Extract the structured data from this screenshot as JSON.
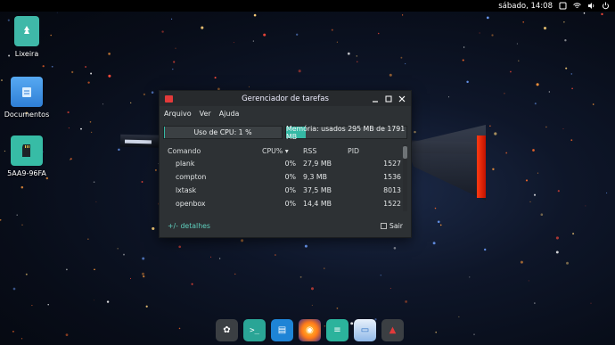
{
  "topbar": {
    "clock": "sábado, 14:08"
  },
  "desktop": {
    "icons": [
      {
        "label": "Lixeira",
        "icon": "trash-icon"
      },
      {
        "label": "Documentos",
        "icon": "folder-icon"
      },
      {
        "label": "5AA9-96FA",
        "icon": "sdcard-icon"
      }
    ]
  },
  "window": {
    "title": "Gerenciador de tarefas",
    "menu": [
      "Arquivo",
      "Ver",
      "Ajuda"
    ],
    "cpu_text": "Uso de CPU: 1 %",
    "cpu_percent": 1,
    "mem_text": "Memória: usados 295 MB de 1791 MB",
    "mem_fraction": 0.165,
    "columns": [
      "Comando",
      "CPU%",
      "RSS",
      "PID"
    ],
    "rows": [
      {
        "cmd": "plank",
        "cpu": "0%",
        "rss": "27,9 MB",
        "pid": "1527"
      },
      {
        "cmd": "compton",
        "cpu": "0%",
        "rss": "9,3 MB",
        "pid": "1536"
      },
      {
        "cmd": "lxtask",
        "cpu": "0%",
        "rss": "37,5 MB",
        "pid": "8013"
      },
      {
        "cmd": "openbox",
        "cpu": "0%",
        "rss": "14,4 MB",
        "pid": "1522"
      }
    ],
    "details_label": "+/- detalhes",
    "quit_label": "Sair"
  },
  "colors": {
    "accent": "#35b9a5",
    "window_bg": "#2d3134"
  }
}
